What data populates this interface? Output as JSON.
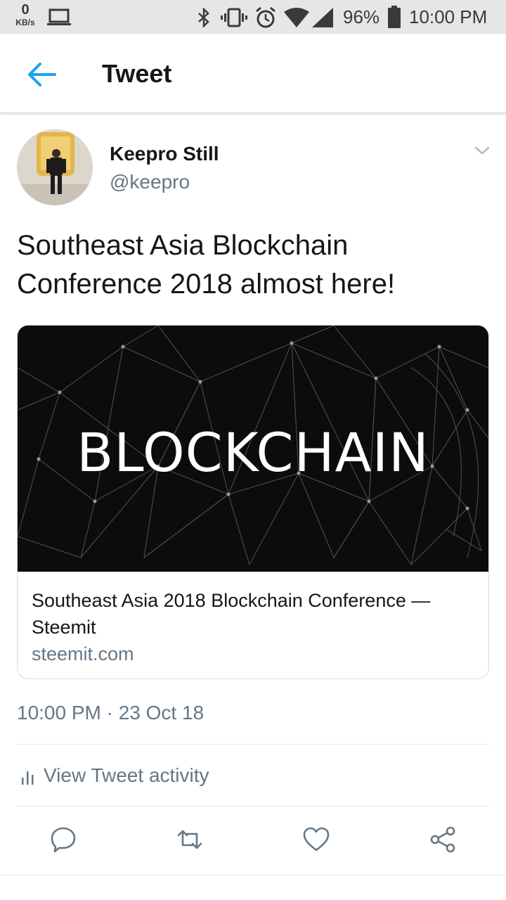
{
  "status_bar": {
    "speed_value": "0",
    "speed_unit": "KB/s",
    "battery_percent": "96%",
    "time": "10:00 PM",
    "icons": [
      "laptop-icon",
      "bluetooth-icon",
      "vibrate-icon",
      "alarm-icon",
      "wifi-icon",
      "signal-icon",
      "battery-icon"
    ]
  },
  "header": {
    "title": "Tweet",
    "back_icon": "arrow-left-icon"
  },
  "tweet": {
    "author_name": "Keepro Still",
    "author_handle": "@keepro",
    "text": "Southeast Asia Blockchain Conference 2018 almost here!",
    "timestamp": "10:00 PM · 23 Oct 18"
  },
  "link_card": {
    "image_text": "BLOCKCHAIN",
    "title": "Southeast Asia 2018 Blockchain Conference — Steemit",
    "domain": "steemit.com"
  },
  "activity": {
    "label": "View Tweet activity",
    "icon": "bar-chart-icon"
  },
  "actions": [
    "reply-icon",
    "retweet-icon",
    "like-icon",
    "share-icon"
  ],
  "colors": {
    "accent": "#1da1f2",
    "secondary_text": "#657786",
    "primary_text": "#14171a",
    "border": "#e1e8ed"
  }
}
